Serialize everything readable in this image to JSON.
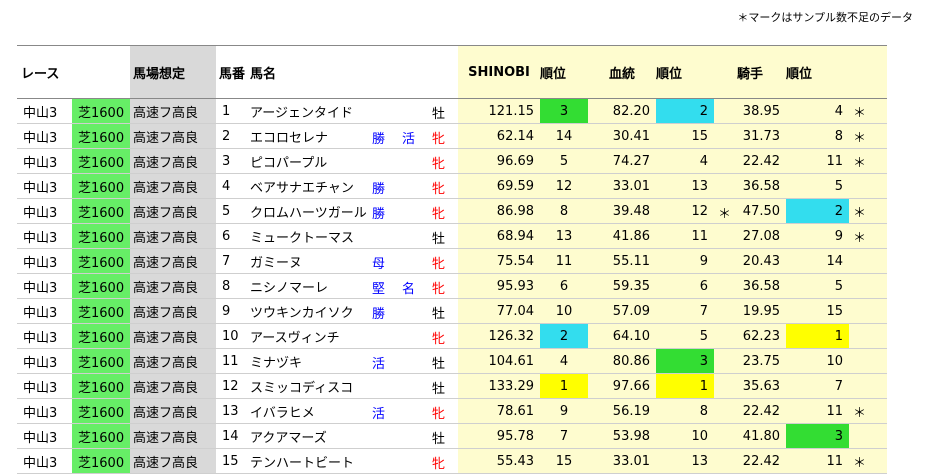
{
  "note": "＊マークはサンプル数不足のデータ",
  "headers": {
    "race": "レース",
    "condition": "馬場想定",
    "number": "馬番",
    "name": "馬名",
    "shinobi": "SHINOBI",
    "rank1": "順位",
    "blood": "血統",
    "rank2": "順位",
    "jockey": "騎手",
    "rank3": "順位"
  },
  "rows": [
    {
      "race": "中山3",
      "course": "芝1600",
      "cond": "高速フ高良",
      "no": "1",
      "name": "アージェンタイド",
      "f1": "",
      "f2": "",
      "sex": "牡",
      "shinobi": "121.15",
      "r1": "3",
      "blood": "82.20",
      "r2": "2",
      "r2mark": "",
      "jockey": "38.95",
      "r3": "4",
      "mark": "＊"
    },
    {
      "race": "中山3",
      "course": "芝1600",
      "cond": "高速フ高良",
      "no": "2",
      "name": "エコロセレナ",
      "f1": "勝",
      "f2": "活",
      "sex": "牝",
      "shinobi": "62.14",
      "r1": "14",
      "blood": "30.41",
      "r2": "15",
      "r2mark": "",
      "jockey": "31.73",
      "r3": "8",
      "mark": "＊"
    },
    {
      "race": "中山3",
      "course": "芝1600",
      "cond": "高速フ高良",
      "no": "3",
      "name": "ピコパープル",
      "f1": "",
      "f2": "",
      "sex": "牝",
      "shinobi": "96.69",
      "r1": "5",
      "blood": "74.27",
      "r2": "4",
      "r2mark": "",
      "jockey": "22.42",
      "r3": "11",
      "mark": "＊"
    },
    {
      "race": "中山3",
      "course": "芝1600",
      "cond": "高速フ高良",
      "no": "4",
      "name": "ベアサナエチャン",
      "f1": "勝",
      "f2": "",
      "sex": "牝",
      "shinobi": "69.59",
      "r1": "12",
      "blood": "33.01",
      "r2": "13",
      "r2mark": "",
      "jockey": "36.58",
      "r3": "5",
      "mark": ""
    },
    {
      "race": "中山3",
      "course": "芝1600",
      "cond": "高速フ高良",
      "no": "5",
      "name": "クロムハーツガール",
      "f1": "勝",
      "f2": "",
      "sex": "牝",
      "shinobi": "86.98",
      "r1": "8",
      "blood": "39.48",
      "r2": "12",
      "r2mark": "＊",
      "jockey": "47.50",
      "r3": "2",
      "mark": "＊"
    },
    {
      "race": "中山3",
      "course": "芝1600",
      "cond": "高速フ高良",
      "no": "6",
      "name": "ミュークトーマス",
      "f1": "",
      "f2": "",
      "sex": "牡",
      "shinobi": "68.94",
      "r1": "13",
      "blood": "41.86",
      "r2": "11",
      "r2mark": "",
      "jockey": "27.08",
      "r3": "9",
      "mark": "＊"
    },
    {
      "race": "中山3",
      "course": "芝1600",
      "cond": "高速フ高良",
      "no": "7",
      "name": "ガミーヌ",
      "f1": "母",
      "f2": "",
      "sex": "牝",
      "shinobi": "75.54",
      "r1": "11",
      "blood": "55.11",
      "r2": "9",
      "r2mark": "",
      "jockey": "20.43",
      "r3": "14",
      "mark": ""
    },
    {
      "race": "中山3",
      "course": "芝1600",
      "cond": "高速フ高良",
      "no": "8",
      "name": "ニシノマーレ",
      "f1": "堅",
      "f2": "名",
      "sex": "牝",
      "shinobi": "95.93",
      "r1": "6",
      "blood": "59.35",
      "r2": "6",
      "r2mark": "",
      "jockey": "36.58",
      "r3": "5",
      "mark": ""
    },
    {
      "race": "中山3",
      "course": "芝1600",
      "cond": "高速フ高良",
      "no": "9",
      "name": "ツウキンカイソク",
      "f1": "勝",
      "f2": "",
      "sex": "牡",
      "shinobi": "77.04",
      "r1": "10",
      "blood": "57.09",
      "r2": "7",
      "r2mark": "",
      "jockey": "19.95",
      "r3": "15",
      "mark": ""
    },
    {
      "race": "中山3",
      "course": "芝1600",
      "cond": "高速フ高良",
      "no": "10",
      "name": "アースヴィンチ",
      "f1": "",
      "f2": "",
      "sex": "牝",
      "shinobi": "126.32",
      "r1": "2",
      "blood": "64.10",
      "r2": "5",
      "r2mark": "",
      "jockey": "62.23",
      "r3": "1",
      "mark": ""
    },
    {
      "race": "中山3",
      "course": "芝1600",
      "cond": "高速フ高良",
      "no": "11",
      "name": "ミナヅキ",
      "f1": "活",
      "f2": "",
      "sex": "牡",
      "shinobi": "104.61",
      "r1": "4",
      "blood": "80.86",
      "r2": "3",
      "r2mark": "",
      "jockey": "23.75",
      "r3": "10",
      "mark": ""
    },
    {
      "race": "中山3",
      "course": "芝1600",
      "cond": "高速フ高良",
      "no": "12",
      "name": "スミッコディスコ",
      "f1": "",
      "f2": "",
      "sex": "牡",
      "shinobi": "133.29",
      "r1": "1",
      "blood": "97.66",
      "r2": "1",
      "r2mark": "",
      "jockey": "35.63",
      "r3": "7",
      "mark": ""
    },
    {
      "race": "中山3",
      "course": "芝1600",
      "cond": "高速フ高良",
      "no": "13",
      "name": "イバラヒメ",
      "f1": "活",
      "f2": "",
      "sex": "牝",
      "shinobi": "78.61",
      "r1": "9",
      "blood": "56.19",
      "r2": "8",
      "r2mark": "",
      "jockey": "22.42",
      "r3": "11",
      "mark": "＊"
    },
    {
      "race": "中山3",
      "course": "芝1600",
      "cond": "高速フ高良",
      "no": "14",
      "name": "アクアマーズ",
      "f1": "",
      "f2": "",
      "sex": "牡",
      "shinobi": "95.78",
      "r1": "7",
      "blood": "53.98",
      "r2": "10",
      "r2mark": "",
      "jockey": "41.80",
      "r3": "3",
      "mark": ""
    },
    {
      "race": "中山3",
      "course": "芝1600",
      "cond": "高速フ高良",
      "no": "15",
      "name": "テンハートビート",
      "f1": "",
      "f2": "",
      "sex": "牝",
      "shinobi": "55.43",
      "r1": "15",
      "blood": "33.01",
      "r2": "13",
      "r2mark": "",
      "jockey": "22.42",
      "r3": "11",
      "mark": "＊"
    }
  ],
  "colors": {
    "rank1": "#33dd33",
    "rank2": "#33ddee",
    "rank3": "#ffff00",
    "score_bg": "#fefccf",
    "course_bg": "#66ee66",
    "condition_bg": "#d9d9d9"
  }
}
